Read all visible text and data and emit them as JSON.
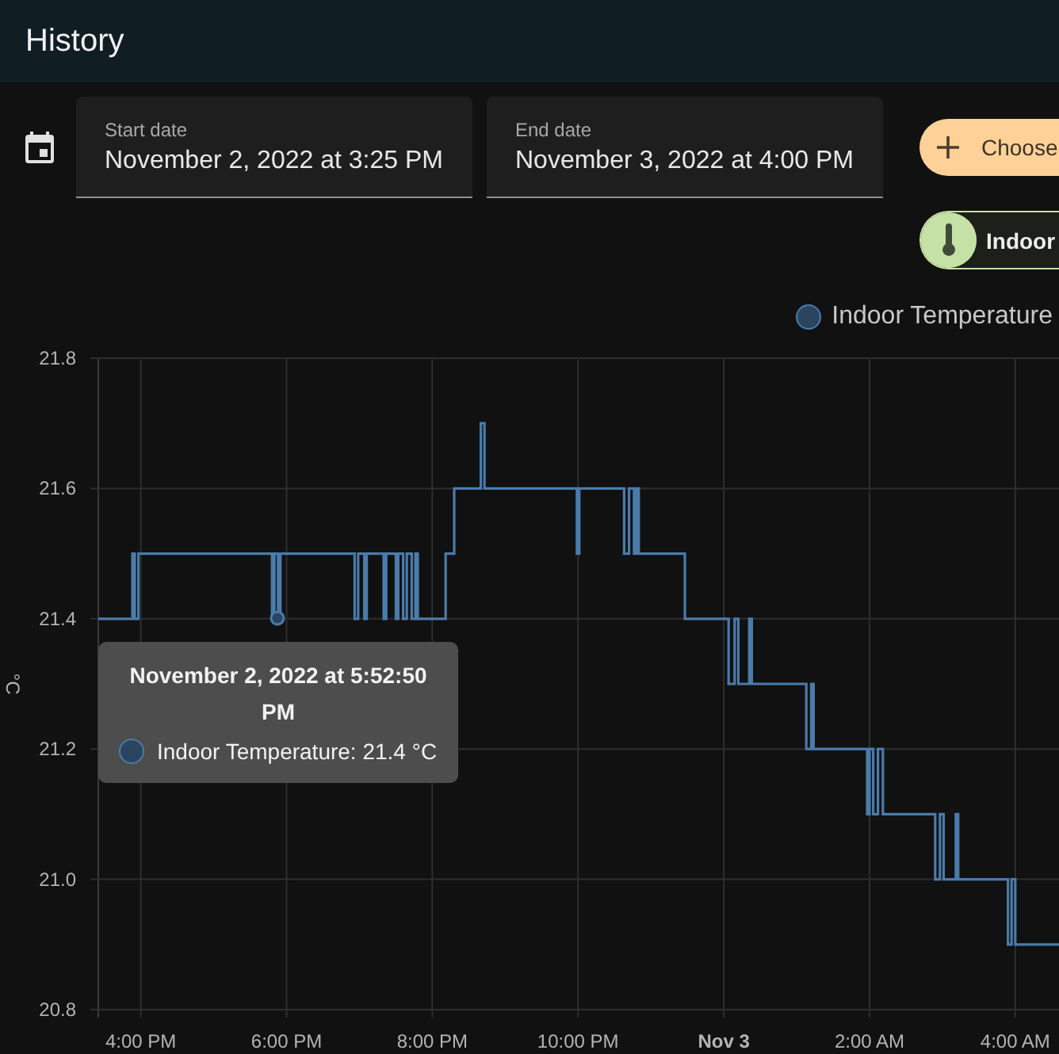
{
  "header": {
    "title": "History"
  },
  "date_range": {
    "start": {
      "label": "Start date",
      "value": "November 2, 2022 at 3:25 PM"
    },
    "end": {
      "label": "End date",
      "value": "November 3, 2022 at 4:00 PM"
    }
  },
  "choose_button": {
    "label": "Choose"
  },
  "entity_chips": [
    {
      "label": "Indoor"
    }
  ],
  "chart": {
    "chart_data": {
      "type": "line",
      "ylabel": "°C",
      "grid": true,
      "xlim": [
        "2022-11-02 15:25",
        "2022-11-03 04:36"
      ],
      "ylim": [
        20.8,
        21.8
      ],
      "xticks": [
        {
          "value": "2022-11-02 16:00",
          "label": "4:00 PM"
        },
        {
          "value": "2022-11-02 18:00",
          "label": "6:00 PM"
        },
        {
          "value": "2022-11-02 20:00",
          "label": "8:00 PM"
        },
        {
          "value": "2022-11-02 22:00",
          "label": "10:00 PM"
        },
        {
          "value": "2022-11-03 00:00",
          "label": "Nov 3"
        },
        {
          "value": "2022-11-03 02:00",
          "label": "2:00 AM"
        },
        {
          "value": "2022-11-03 04:00",
          "label": "4:00 AM"
        }
      ],
      "yticks": [
        {
          "value": 20.8,
          "label": "20.8"
        },
        {
          "value": 21.0,
          "label": "21.0"
        },
        {
          "value": 21.2,
          "label": "21.2"
        },
        {
          "value": 21.4,
          "label": "21.4"
        },
        {
          "value": 21.6,
          "label": "21.6"
        },
        {
          "value": 21.8,
          "label": "21.8"
        }
      ],
      "x": [
        "2022-11-02 15:25",
        "2022-11-02 15:53",
        "2022-11-02 15:53",
        "2022-11-02 15:55",
        "2022-11-02 15:55",
        "2022-11-02 15:58",
        "2022-11-02 15:58",
        "2022-11-02 17:48",
        "2022-11-02 17:48",
        "2022-11-02 17:50",
        "2022-11-02 17:50",
        "2022-11-02 17:53",
        "2022-11-02 17:53",
        "2022-11-02 17:55",
        "2022-11-02 17:55",
        "2022-11-02 18:56",
        "2022-11-02 18:56",
        "2022-11-02 18:59",
        "2022-11-02 18:59",
        "2022-11-02 19:04",
        "2022-11-02 19:04",
        "2022-11-02 19:06",
        "2022-11-02 19:06",
        "2022-11-02 19:20",
        "2022-11-02 19:20",
        "2022-11-02 19:22",
        "2022-11-02 19:22",
        "2022-11-02 19:30",
        "2022-11-02 19:30",
        "2022-11-02 19:32",
        "2022-11-02 19:32",
        "2022-11-02 19:36",
        "2022-11-02 19:36",
        "2022-11-02 19:39",
        "2022-11-02 19:39",
        "2022-11-02 19:43",
        "2022-11-02 19:43",
        "2022-11-02 19:46",
        "2022-11-02 19:46",
        "2022-11-02 19:48",
        "2022-11-02 19:48",
        "2022-11-02 20:11",
        "2022-11-02 20:11",
        "2022-11-02 20:18",
        "2022-11-02 20:18",
        "2022-11-02 20:40",
        "2022-11-02 20:40",
        "2022-11-02 20:43",
        "2022-11-02 20:43",
        "2022-11-02 21:59",
        "2022-11-02 21:59",
        "2022-11-02 22:01",
        "2022-11-02 22:01",
        "2022-11-02 22:38",
        "2022-11-02 22:38",
        "2022-11-02 22:42",
        "2022-11-02 22:42",
        "2022-11-02 22:46",
        "2022-11-02 22:46",
        "2022-11-02 22:48",
        "2022-11-02 22:48",
        "2022-11-02 22:50",
        "2022-11-02 22:50",
        "2022-11-02 23:28",
        "2022-11-02 23:28",
        "2022-11-03 00:04",
        "2022-11-03 00:04",
        "2022-11-03 00:09",
        "2022-11-03 00:09",
        "2022-11-03 00:12",
        "2022-11-03 00:12",
        "2022-11-03 00:21",
        "2022-11-03 00:21",
        "2022-11-03 00:23",
        "2022-11-03 00:23",
        "2022-11-03 01:08",
        "2022-11-03 01:08",
        "2022-11-03 01:12",
        "2022-11-03 01:12",
        "2022-11-03 01:14",
        "2022-11-03 01:14",
        "2022-11-03 01:58",
        "2022-11-03 01:58",
        "2022-11-03 02:00",
        "2022-11-03 02:00",
        "2022-11-03 02:03",
        "2022-11-03 02:03",
        "2022-11-03 02:07",
        "2022-11-03 02:07",
        "2022-11-03 02:11",
        "2022-11-03 02:11",
        "2022-11-03 02:54",
        "2022-11-03 02:54",
        "2022-11-03 02:58",
        "2022-11-03 02:58",
        "2022-11-03 03:01",
        "2022-11-03 03:01",
        "2022-11-03 03:11",
        "2022-11-03 03:11",
        "2022-11-03 03:13",
        "2022-11-03 03:13",
        "2022-11-03 03:54",
        "2022-11-03 03:54",
        "2022-11-03 03:57",
        "2022-11-03 03:57",
        "2022-11-03 04:00",
        "2022-11-03 04:00",
        "2022-11-03 04:36"
      ],
      "series": [
        {
          "name": "Indoor Temperature",
          "color": "#4a7bab",
          "values": [
            21.4,
            21.4,
            21.5,
            21.5,
            21.4,
            21.4,
            21.5,
            21.5,
            21.4,
            21.4,
            21.5,
            21.5,
            21.4,
            21.4,
            21.5,
            21.5,
            21.4,
            21.4,
            21.5,
            21.5,
            21.4,
            21.4,
            21.5,
            21.5,
            21.4,
            21.4,
            21.5,
            21.5,
            21.4,
            21.4,
            21.5,
            21.5,
            21.4,
            21.4,
            21.5,
            21.5,
            21.4,
            21.4,
            21.5,
            21.5,
            21.4,
            21.4,
            21.5,
            21.5,
            21.6,
            21.6,
            21.7,
            21.7,
            21.6,
            21.6,
            21.5,
            21.5,
            21.6,
            21.6,
            21.5,
            21.5,
            21.6,
            21.6,
            21.5,
            21.5,
            21.6,
            21.6,
            21.5,
            21.5,
            21.4,
            21.4,
            21.3,
            21.3,
            21.4,
            21.4,
            21.3,
            21.3,
            21.4,
            21.4,
            21.3,
            21.3,
            21.2,
            21.2,
            21.3,
            21.3,
            21.2,
            21.2,
            21.1,
            21.1,
            21.2,
            21.2,
            21.1,
            21.1,
            21.2,
            21.2,
            21.1,
            21.1,
            21.0,
            21.0,
            21.1,
            21.1,
            21.0,
            21.0,
            21.1,
            21.1,
            21.0,
            21.0,
            20.9,
            20.9,
            21.0,
            21.0,
            20.9,
            20.9
          ]
        }
      ]
    },
    "tooltip": {
      "title": "November 2, 2022 at 5:52:50 PM",
      "label": "Indoor Temperature: 21.4 °C"
    }
  }
}
